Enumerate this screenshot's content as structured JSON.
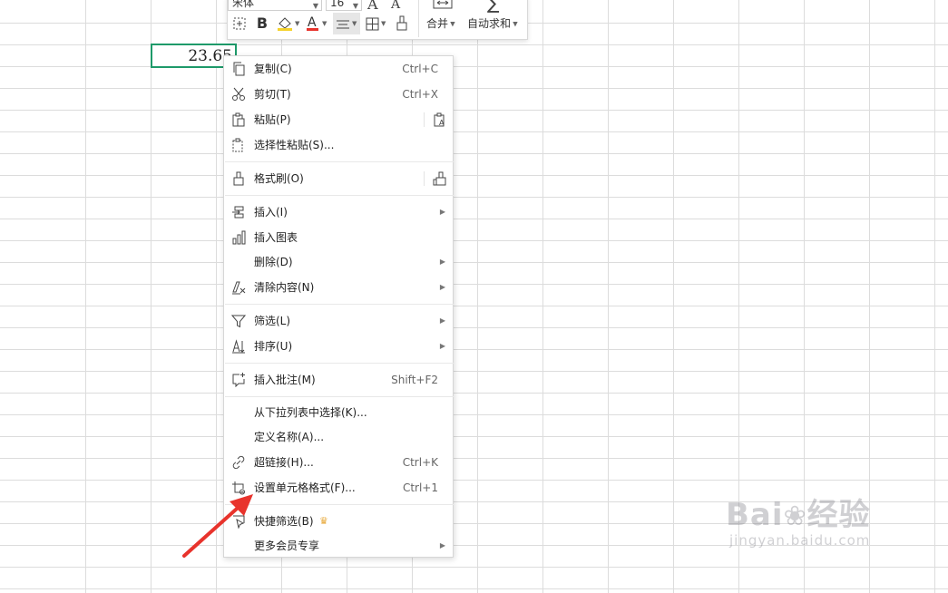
{
  "cell": {
    "value": "23.65"
  },
  "toolbar": {
    "font_name": "宋体",
    "font_size": "16",
    "merge_label": "合并",
    "autosum_label": "自动求和"
  },
  "menu": {
    "copy": {
      "label": "复制(C)",
      "shortcut": "Ctrl+C"
    },
    "cut": {
      "label": "剪切(T)",
      "shortcut": "Ctrl+X"
    },
    "paste": {
      "label": "粘贴(P)"
    },
    "paste_special": {
      "label": "选择性粘贴(S)..."
    },
    "format_painter": {
      "label": "格式刷(O)"
    },
    "insert": {
      "label": "插入(I)"
    },
    "insert_chart": {
      "label": "插入图表"
    },
    "delete": {
      "label": "删除(D)"
    },
    "clear_content": {
      "label": "清除内容(N)"
    },
    "filter": {
      "label": "筛选(L)"
    },
    "sort": {
      "label": "排序(U)"
    },
    "insert_comment": {
      "label": "插入批注(M)",
      "shortcut": "Shift+F2"
    },
    "pick_from_list": {
      "label": "从下拉列表中选择(K)..."
    },
    "define_name": {
      "label": "定义名称(A)..."
    },
    "hyperlink": {
      "label": "超链接(H)...",
      "shortcut": "Ctrl+K"
    },
    "format_cells": {
      "label": "设置单元格格式(F)...",
      "shortcut": "Ctrl+1"
    },
    "quick_filter": {
      "label": "快捷筛选(B)"
    },
    "more_vip": {
      "label": "更多会员专享"
    }
  },
  "watermark": {
    "main": "Bai",
    "main2": "经验",
    "sub": "jingyan.baidu.com"
  },
  "colors": {
    "cell_border": "#1e9a6a",
    "arrow": "#e8332c",
    "font_color_bar": "#e8332c",
    "highlight_bar": "#f5d22b"
  }
}
